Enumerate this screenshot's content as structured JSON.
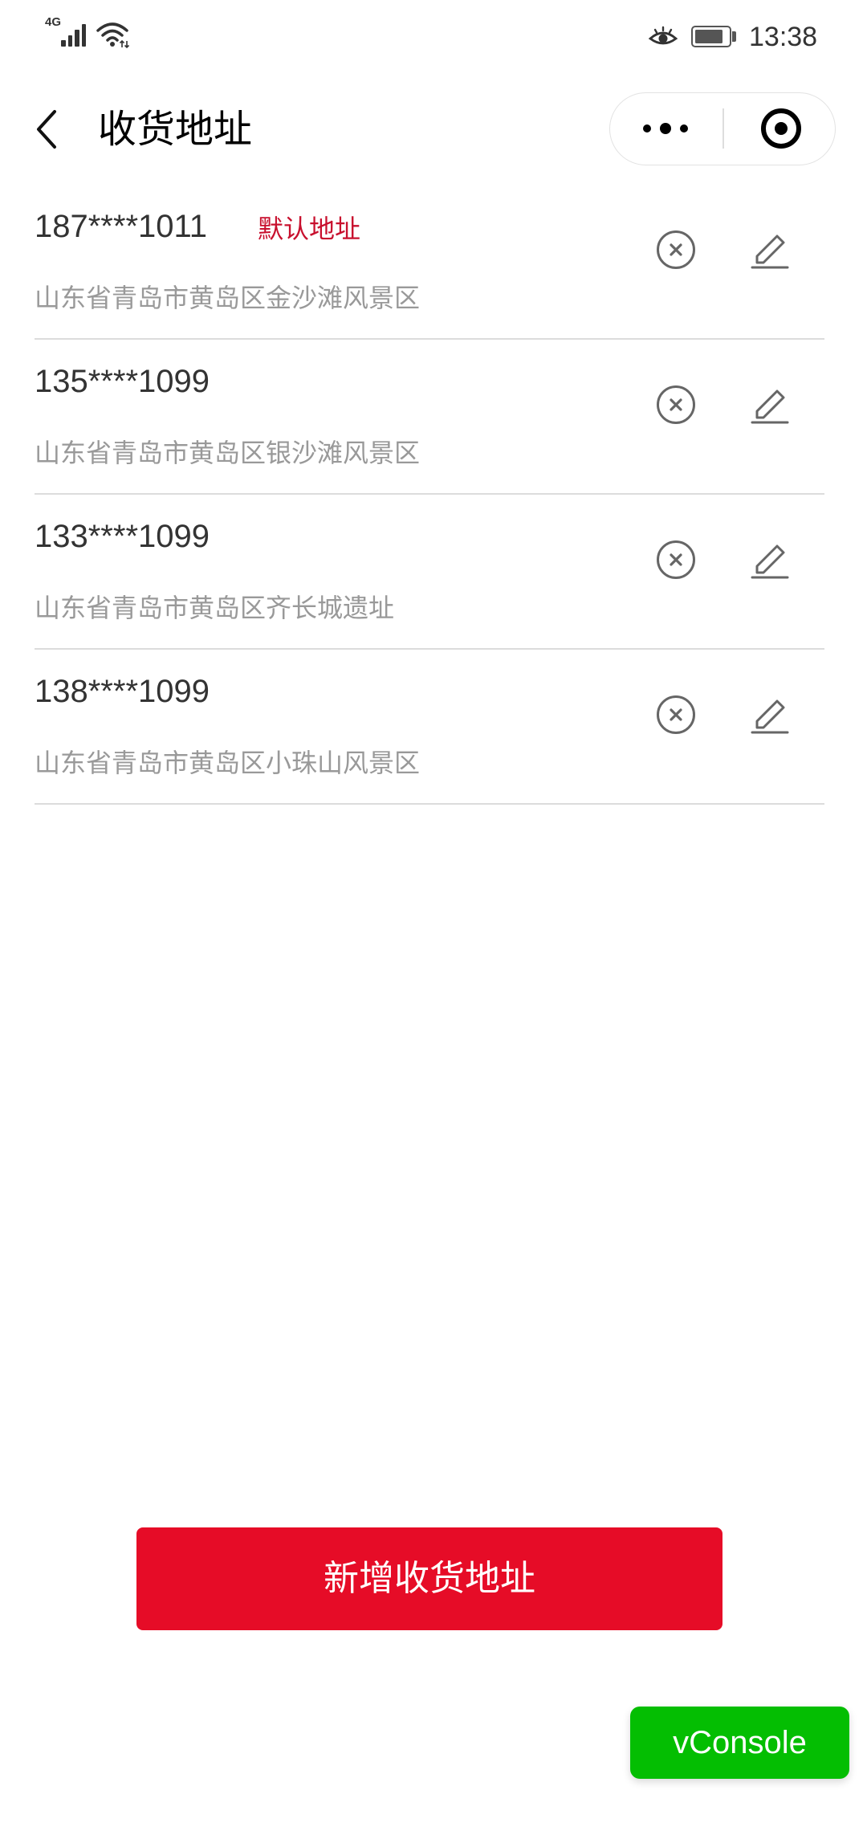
{
  "status_bar": {
    "network": "4G",
    "time": "13:38",
    "battery_level": 0.85,
    "icons": [
      "signal-icon",
      "wifi-icon",
      "eye-icon",
      "battery-icon"
    ]
  },
  "nav": {
    "title": "收货地址",
    "icons": [
      "back-icon",
      "more-icon",
      "target-icon"
    ]
  },
  "addresses": [
    {
      "phone": "187****1011",
      "default_tag": "默认地址",
      "address": "山东省青岛市黄岛区金沙滩风景区"
    },
    {
      "phone": "135****1099",
      "address": "山东省青岛市黄岛区银沙滩风景区"
    },
    {
      "phone": "133****1099",
      "address": "山东省青岛市黄岛区齐长城遗址"
    },
    {
      "phone": "138****1099",
      "address": "山东省青岛市黄岛区小珠山风景区"
    }
  ],
  "address_item_icons": [
    "delete-icon",
    "edit-icon"
  ],
  "add_button": {
    "label": "新增收货地址"
  },
  "vconsole": {
    "label": "vConsole"
  },
  "colors": {
    "accent": "#E60C27",
    "default_tag": "#C8102E",
    "vconsole": "#04BE02",
    "address_text": "#999999"
  }
}
